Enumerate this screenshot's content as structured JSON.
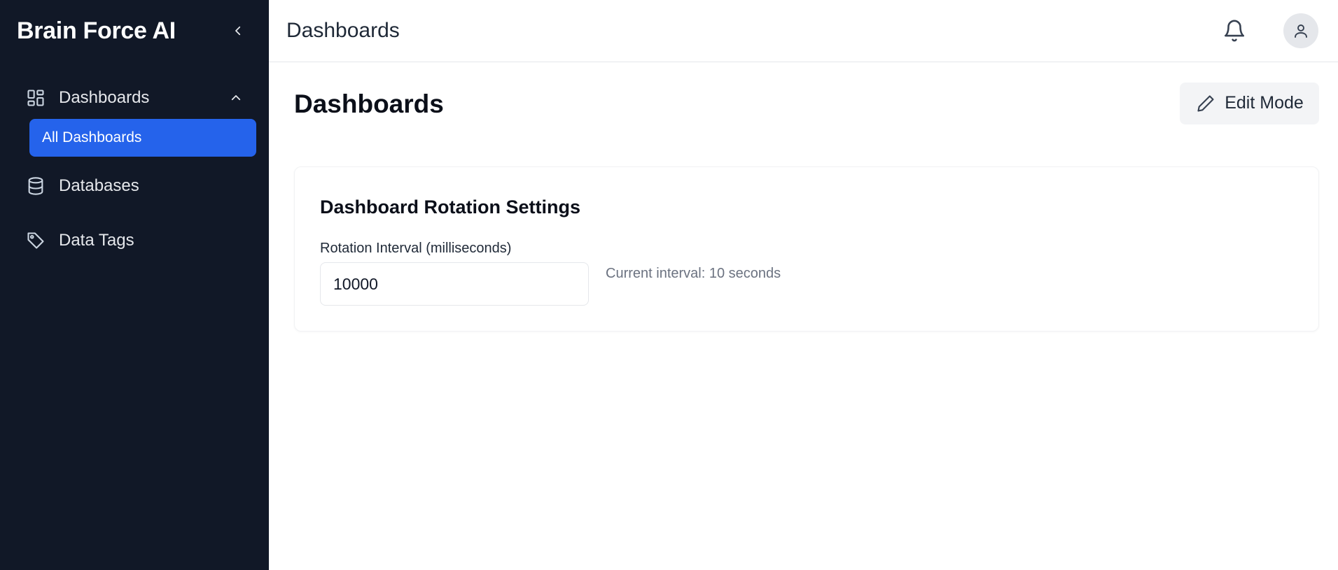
{
  "sidebar": {
    "brand": "Brain Force AI",
    "items": [
      {
        "label": "Dashboards",
        "icon": "dashboard-grid-icon",
        "expanded": true
      },
      {
        "label": "Databases",
        "icon": "database-icon"
      },
      {
        "label": "Data Tags",
        "icon": "tag-icon"
      }
    ],
    "subitems": [
      {
        "label": "All Dashboards",
        "active": true
      }
    ],
    "active_color": "#2563eb",
    "background": "#111827"
  },
  "topbar": {
    "title": "Dashboards",
    "icons": [
      "bell-icon",
      "user-icon"
    ]
  },
  "main": {
    "page_title": "Dashboards",
    "edit_button": "Edit Mode",
    "card": {
      "title": "Dashboard Rotation Settings",
      "field_label": "Rotation Interval (milliseconds)",
      "field_value": "10000",
      "hint": "Current interval: 10 seconds"
    }
  }
}
